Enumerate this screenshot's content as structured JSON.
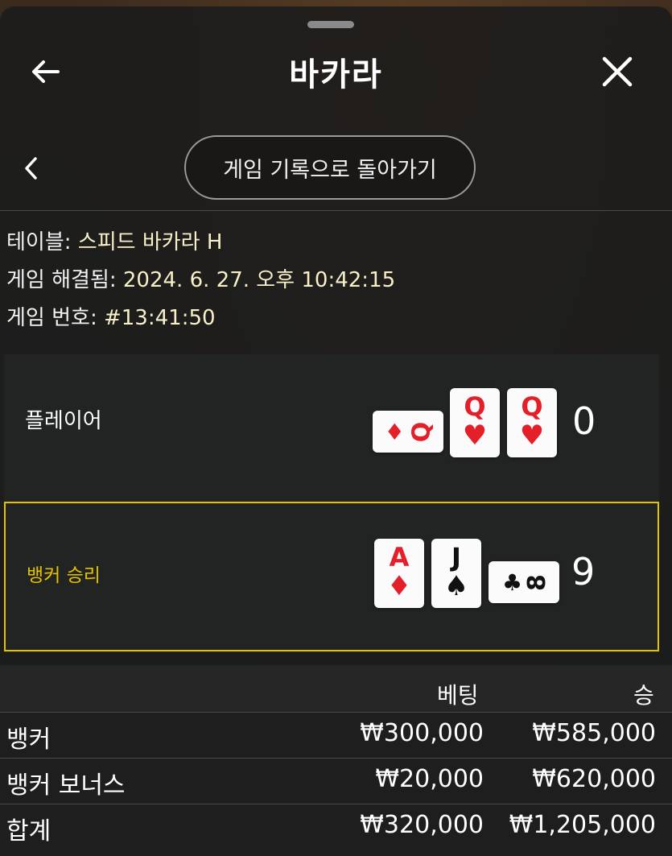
{
  "header": {
    "title": "바카라",
    "back_icon": "back-arrow-icon",
    "close_icon": "close-icon"
  },
  "history": {
    "back_chevron_icon": "chevron-left-icon",
    "return_button_label": "게임 기록으로 돌아가기"
  },
  "info": {
    "table_label": "테이블:",
    "table_value": "스피드 바카라 H",
    "resolved_label": "게임 해결됨:",
    "resolved_value": "2024. 6. 27. 오후 10:42:15",
    "game_no_label": "게임 번호:",
    "game_no_value": "#13:41:50"
  },
  "result": {
    "player": {
      "label": "플레이어",
      "score": "0",
      "cards": [
        {
          "rank": "Q",
          "suit": "♦",
          "color": "#e3202a",
          "rotated": true
        },
        {
          "rank": "Q",
          "suit": "♥",
          "color": "#e3202a",
          "rotated": false
        },
        {
          "rank": "Q",
          "suit": "♥",
          "color": "#e3202a",
          "rotated": false
        }
      ]
    },
    "banker": {
      "label": "뱅커 승리",
      "label_color": "#e5c200",
      "score": "9",
      "cards": [
        {
          "rank": "A",
          "suit": "♦",
          "color": "#e3202a",
          "rotated": false
        },
        {
          "rank": "J",
          "suit": "♠",
          "color": "#111111",
          "rotated": false
        },
        {
          "rank": "8",
          "suit": "♣",
          "color": "#111111",
          "rotated": true
        }
      ]
    }
  },
  "bets": {
    "headers": {
      "bet": "베팅",
      "win": "승"
    },
    "rows": [
      {
        "name": "뱅커",
        "bet": "₩300,000",
        "win": "₩585,000"
      },
      {
        "name": "뱅커 보너스",
        "bet": "₩20,000",
        "win": "₩620,000"
      }
    ],
    "total": {
      "name": "합계",
      "bet": "₩320,000",
      "win": "₩1,205,000"
    }
  }
}
